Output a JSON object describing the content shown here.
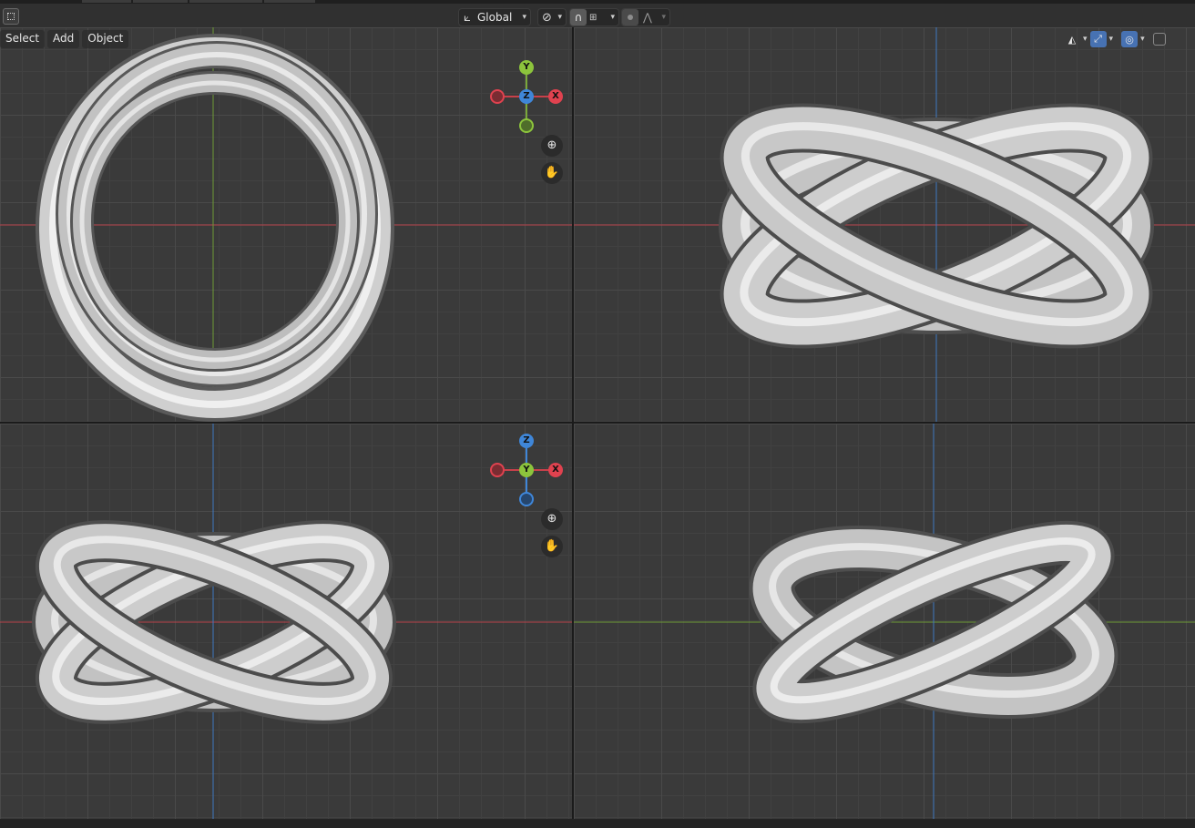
{
  "header": {
    "orientation_label": "Global",
    "orientation_icon": "transform-orientation-icon",
    "pivot_icon": "pivot-point-icon",
    "snap_icon": "magnet-snap-icon",
    "snap_target_icon": "snap-increment-icon",
    "proportional_icon": "proportional-edit-icon",
    "falloff_icon": "falloff-curve-icon"
  },
  "menu": {
    "select": "Select",
    "add": "Add",
    "object": "Object"
  },
  "viewport_controls": {
    "select_icon": "object-type-visibility-icon",
    "gizmo_icon": "viewport-gizmos-icon",
    "overlay_icon": "overlays-icon",
    "xray_icon": "toggle-xray-icon"
  },
  "gizmo_top": {
    "up": "Y",
    "center": "Z",
    "right": "X"
  },
  "gizmo_front": {
    "up": "Z",
    "center": "Y",
    "right": "X"
  },
  "colors": {
    "x_axis": "#e0424f",
    "y_axis": "#8cc43c",
    "z_axis": "#3f86d8",
    "grid": "#3a3a3a",
    "mesh": "#c8c8c8"
  }
}
